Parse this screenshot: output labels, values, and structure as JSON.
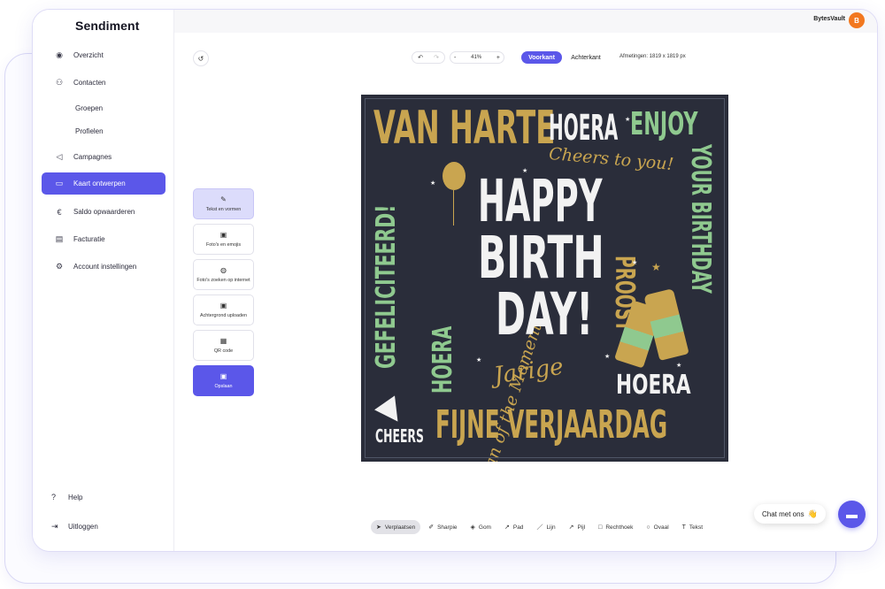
{
  "brand": "Sendiment",
  "user": {
    "name": "BytesVault",
    "initial": "B"
  },
  "colors": {
    "accent": "#5b57e9",
    "avatar": "#f2781f",
    "card_bg": "#2a2d3a",
    "gold": "#c9a550",
    "green": "#8fc98f"
  },
  "sidebar": {
    "items": [
      {
        "label": "Overzicht",
        "icon": "eye-icon"
      },
      {
        "label": "Contacten",
        "icon": "users-icon"
      },
      {
        "label": "Groepen",
        "icon": ""
      },
      {
        "label": "Profielen",
        "icon": ""
      },
      {
        "label": "Campagnes",
        "icon": "megaphone-icon"
      },
      {
        "label": "Kaart ontwerpen",
        "icon": "card-icon"
      },
      {
        "label": "Saldo opwaarderen",
        "icon": "euro-icon"
      },
      {
        "label": "Facturatie",
        "icon": "invoice-icon"
      },
      {
        "label": "Account instellingen",
        "icon": "gear-icon"
      }
    ],
    "footer": [
      {
        "label": "Help",
        "icon": "help-icon"
      },
      {
        "label": "Uitloggen",
        "icon": "logout-icon"
      }
    ]
  },
  "toolbar": {
    "zoom": "41%",
    "zoom_minus": "-",
    "zoom_plus": "+",
    "front_label": "Voorkant",
    "back_label": "Achterkant",
    "dimensions": "Afmetingen: 1819 x 1819 px"
  },
  "tools": [
    {
      "label": "Tekst en vormen",
      "icon": "pen-icon"
    },
    {
      "label": "Foto's en emojis",
      "icon": "image-icon"
    },
    {
      "label": "Foto's zoeken op internet",
      "icon": "globe-icon"
    },
    {
      "label": "Achtergrond uploaden",
      "icon": "image-icon"
    },
    {
      "label": "QR code",
      "icon": "qr-icon"
    },
    {
      "label": "Opslaan",
      "icon": "save-icon"
    }
  ],
  "card": {
    "van_harte": "VAN HARTE",
    "hoera_top": "HOERA",
    "enjoy": "ENJOY",
    "cheers_to_you": "Cheers to you!",
    "gefeliciteerd": "GEFELICITEERD!",
    "man_of_moment": "Man of the Moment",
    "happy": "HAPPY",
    "birth": "BIRTH",
    "day": "DAY!",
    "proost": "PROOST",
    "your_birthday": "YOUR BIRTHDAY",
    "hoera_left": "HOERA",
    "jarige": "Jarige",
    "hoera_right": "HOERA",
    "cheers": "CHEERS",
    "fijne": "FIJNE VERJAARDAG"
  },
  "draw_tools": [
    {
      "label": "Verplaatsen",
      "icon": "cursor-icon"
    },
    {
      "label": "Sharpie",
      "icon": "sharpie-icon"
    },
    {
      "label": "Gom",
      "icon": "eraser-icon"
    },
    {
      "label": "Pad",
      "icon": "path-icon"
    },
    {
      "label": "Lijn",
      "icon": "line-icon"
    },
    {
      "label": "Pijl",
      "icon": "arrow-icon"
    },
    {
      "label": "Rechthoek",
      "icon": "rectangle-icon"
    },
    {
      "label": "Ovaal",
      "icon": "oval-icon"
    },
    {
      "label": "Tekst",
      "icon": "text-icon"
    }
  ],
  "chat": {
    "label": "Chat met ons",
    "emoji": "👋"
  }
}
